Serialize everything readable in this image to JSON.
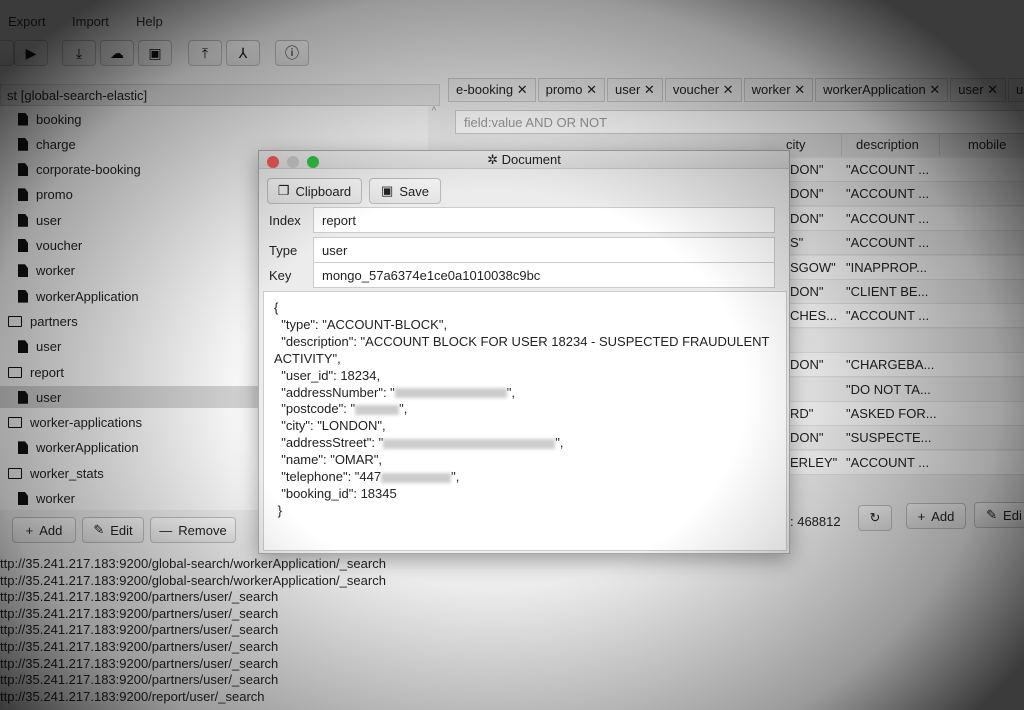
{
  "menu": [
    "Export",
    "Import",
    "Help"
  ],
  "toolbar": {
    "icons": [
      "play-icon",
      "download-icon",
      "cloud-upload-icon",
      "save-icon",
      "upload-icon",
      "cluster-icon",
      "help-icon"
    ]
  },
  "tree": {
    "header": "st [global-search-elastic]",
    "items": [
      {
        "label": "booking",
        "type": "file",
        "level": 2
      },
      {
        "label": "charge",
        "type": "file",
        "level": 2
      },
      {
        "label": "corporate-booking",
        "type": "file",
        "level": 2
      },
      {
        "label": "promo",
        "type": "file",
        "level": 2
      },
      {
        "label": "user",
        "type": "file",
        "level": 2
      },
      {
        "label": "voucher",
        "type": "file",
        "level": 2
      },
      {
        "label": "worker",
        "type": "file",
        "level": 2
      },
      {
        "label": "workerApplication",
        "type": "file",
        "level": 2
      },
      {
        "label": "partners",
        "type": "folder",
        "level": 1
      },
      {
        "label": "user",
        "type": "file",
        "level": 2
      },
      {
        "label": "report",
        "type": "folder",
        "level": 1
      },
      {
        "label": "user",
        "type": "file",
        "level": 2,
        "selected": true
      },
      {
        "label": "worker-applications",
        "type": "folder",
        "level": 1
      },
      {
        "label": "workerApplication",
        "type": "file",
        "level": 2
      },
      {
        "label": "worker_stats",
        "type": "folder",
        "level": 1
      },
      {
        "label": "worker",
        "type": "file",
        "level": 2
      }
    ]
  },
  "left_buttons": {
    "add": "Add",
    "edit": "Edit",
    "remove": "Remove"
  },
  "log": [
    "ttp://35.241.217.183:9200/global-search/workerApplication/_search",
    "ttp://35.241.217.183:9200/global-search/workerApplication/_search",
    "ttp://35.241.217.183:9200/partners/user/_search",
    "ttp://35.241.217.183:9200/partners/user/_search",
    "ttp://35.241.217.183:9200/partners/user/_search",
    "ttp://35.241.217.183:9200/partners/user/_search",
    "ttp://35.241.217.183:9200/partners/user/_search",
    "ttp://35.241.217.183:9200/partners/user/_search",
    "ttp://35.241.217.183:9200/report/user/_search"
  ],
  "tabs": [
    "e-booking",
    "promo",
    "user",
    "voucher",
    "worker",
    "workerApplication",
    "user",
    "us"
  ],
  "search": {
    "placeholder": "field:value AND OR NOT"
  },
  "table": {
    "columns": [
      "city",
      "description",
      "mobile"
    ],
    "rows": [
      [
        "DON\"",
        "\"ACCOUNT ..."
      ],
      [
        "DON\"",
        "\"ACCOUNT ..."
      ],
      [
        "DON\"",
        "\"ACCOUNT ..."
      ],
      [
        "S\"",
        "\"ACCOUNT ..."
      ],
      [
        "SGOW\"",
        "\"INAPPROP..."
      ],
      [
        "DON\"",
        "\"CLIENT BE..."
      ],
      [
        "CHES...",
        "\"ACCOUNT ..."
      ],
      [
        "",
        ""
      ],
      [
        "DON\"",
        "\"CHARGEBA..."
      ],
      [
        "",
        "\"DO NOT TA..."
      ],
      [
        "RD\"",
        "\"ASKED FOR..."
      ],
      [
        "DON\"",
        "\"SUSPECTE..."
      ],
      [
        "ERLEY\"",
        "\"ACCOUNT ..."
      ]
    ]
  },
  "right_footer": {
    "count": ": 468812",
    "add": "Add",
    "edit": "Edi"
  },
  "dialog": {
    "title": "Document",
    "clipboard": "Clipboard",
    "save": "Save",
    "fields": [
      {
        "label": "Index",
        "value": "report"
      },
      {
        "label": "Type",
        "value": "user"
      },
      {
        "label": "Key",
        "value": "mongo_57a6374e1ce0a1010038c9bc"
      }
    ],
    "json": {
      "open": "{",
      "type": "  \"type\": \"ACCOUNT-BLOCK\",",
      "description": "  \"description\": \"ACCOUNT BLOCK FOR USER 18234 - SUSPECTED FRAUDULENT ACTIVITY\",",
      "user_id": "  \"user_id\": 18234,",
      "addressNumber": "  \"addressNumber\": \"",
      "postcode": "  \"postcode\": \"",
      "city": "  \"city\": \"LONDON\",",
      "addressStreet": "  \"addressStreet\": \"",
      "name": "  \"name\": \"OMAR\",",
      "telephone": "  \"telephone\": \"447",
      "booking_id": "  \"booking_id\": 18345",
      "close": " }",
      "quote_comma": "\","
    }
  }
}
